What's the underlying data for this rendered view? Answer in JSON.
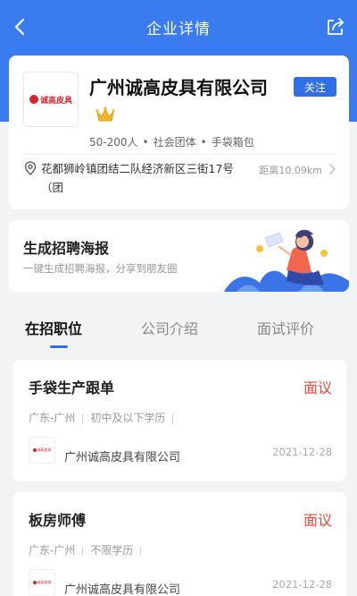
{
  "header": {
    "title": "企业详情"
  },
  "company": {
    "name": "广州诚高皮具有限公司",
    "logo_text": "诚高皮具",
    "follow_label": "关注",
    "tags": [
      "50-200人",
      "社会团体",
      "手袋箱包"
    ],
    "address": "花都狮岭镇团结二队经济新区三街17号（团",
    "distance": "距离10.09km"
  },
  "poster": {
    "title": "生成招聘海报",
    "subtitle": "一键生成招聘海报，分享到朋友圈"
  },
  "tabs": [
    {
      "label": "在招职位"
    },
    {
      "label": "公司介绍"
    },
    {
      "label": "面试评价"
    }
  ],
  "jobs": [
    {
      "title": "手袋生产跟单",
      "salary": "面议",
      "location": "广东-广州",
      "requirement": "初中及以下学历",
      "company": "广州诚高皮具有限公司",
      "date": "2021-12-28"
    },
    {
      "title": "板房师傅",
      "salary": "面议",
      "location": "广东-广州",
      "requirement": "不限学历",
      "company": "广州诚高皮具有限公司",
      "date": "2021-12-28"
    }
  ],
  "colors": {
    "header_blue": "#3a7bf0",
    "accent": "#2f6fe8",
    "salary_red": "#e9473a",
    "brand_red": "#d0262e"
  },
  "icons": [
    "back-icon",
    "share-icon",
    "crown-icon",
    "location-icon",
    "chevron-right-icon"
  ]
}
